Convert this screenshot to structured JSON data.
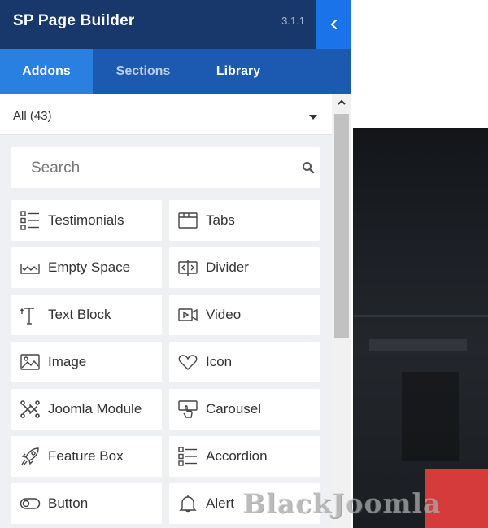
{
  "header": {
    "title": "SP Page Builder",
    "version": "3.1.1",
    "collapse_icon": "chevron-left-icon"
  },
  "tabs": [
    {
      "label": "Addons",
      "active": true
    },
    {
      "label": "Sections",
      "active": false
    },
    {
      "label": "Library",
      "active": false
    }
  ],
  "filter": {
    "value": "All (43)"
  },
  "search": {
    "placeholder": "Search"
  },
  "addons": [
    {
      "label": "Testimonials",
      "icon": "list-icon"
    },
    {
      "label": "Tabs",
      "icon": "tabs-icon"
    },
    {
      "label": "Empty Space",
      "icon": "empty-space-icon"
    },
    {
      "label": "Divider",
      "icon": "divider-icon"
    },
    {
      "label": "Text Block",
      "icon": "text-block-icon"
    },
    {
      "label": "Video",
      "icon": "video-icon"
    },
    {
      "label": "Image",
      "icon": "image-icon"
    },
    {
      "label": "Icon",
      "icon": "heart-icon"
    },
    {
      "label": "Joomla Module",
      "icon": "joomla-icon"
    },
    {
      "label": "Carousel",
      "icon": "carousel-icon"
    },
    {
      "label": "Feature Box",
      "icon": "rocket-icon"
    },
    {
      "label": "Accordion",
      "icon": "accordion-icon"
    },
    {
      "label": "Button",
      "icon": "toggle-icon"
    },
    {
      "label": "Alert",
      "icon": "bell-icon"
    }
  ],
  "watermark": {
    "text": "BlackJoomla"
  },
  "colors": {
    "header_bg": "#18386b",
    "tab_bar_bg": "#1c59b0",
    "active_tab_bg": "#2a80e0",
    "collapse_btn_bg": "#1a73e8",
    "panel_bg": "#eef0f3",
    "accent_red": "#d63b3b"
  }
}
